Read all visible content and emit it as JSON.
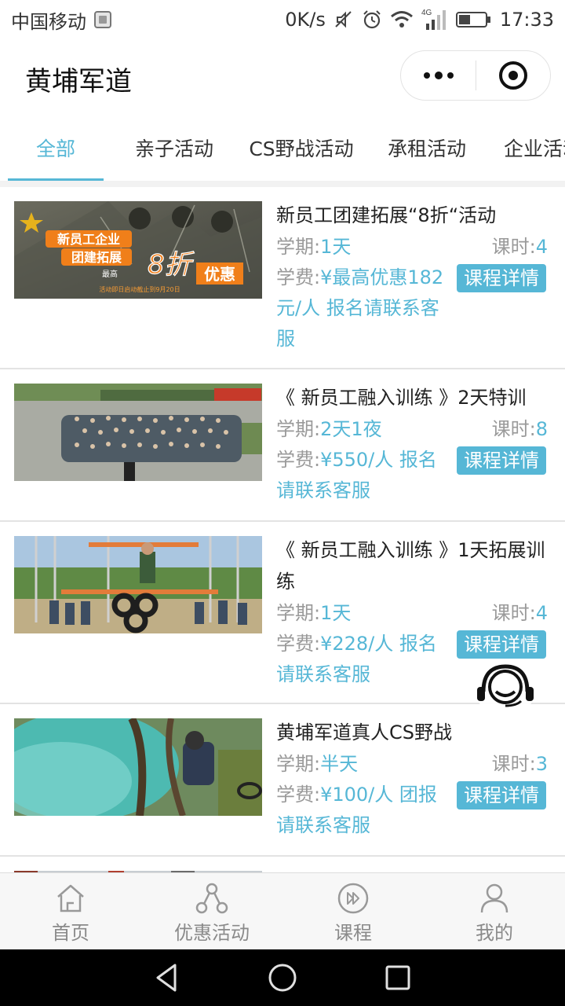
{
  "status_bar": {
    "carrier": "中国移动",
    "net_speed": "0K/s",
    "network_type": "4G",
    "time": "17:33",
    "icons": [
      "sim-icon",
      "mute-icon",
      "alarm-icon",
      "wifi-icon",
      "signal-icon",
      "battery-icon"
    ]
  },
  "header": {
    "title": "黄埔军道"
  },
  "tabs": [
    {
      "label": "全部",
      "active": true
    },
    {
      "label": "亲子活动",
      "active": false
    },
    {
      "label": "CS野战活动",
      "active": false
    },
    {
      "label": "承租活动",
      "active": false
    },
    {
      "label": "企业活动",
      "active": false
    }
  ],
  "courses": [
    {
      "title": "新员工团建拓展“8折“活动",
      "term_label": "学期:",
      "term_value": "1天",
      "hours_label": "课时:",
      "hours_value": "4",
      "fee_label": "学费:",
      "fee_value": "¥最高优惠182元/人 报名请联系客服",
      "detail_button": "课程详情",
      "banner": {
        "line1": "新员工企业",
        "line2": "团建拓展",
        "small": "最高",
        "discount": "8折",
        "highlight": "优惠",
        "footnote": "活动即日启动截止到9月20日"
      }
    },
    {
      "title": "《 新员工融入训练 》2天特训",
      "term_label": "学期:",
      "term_value": "2天1夜",
      "hours_label": "课时:",
      "hours_value": "8",
      "fee_label": "学费:",
      "fee_value": "¥550/人 报名请联系客服",
      "detail_button": "课程详情"
    },
    {
      "title": "《 新员工融入训练 》1天拓展训练",
      "term_label": "学期:",
      "term_value": "1天",
      "hours_label": "课时:",
      "hours_value": "4",
      "fee_label": "学费:",
      "fee_value": "¥228/人 报名请联系客服",
      "detail_button": "课程详情"
    },
    {
      "title": "黄埔军道真人CS野战",
      "term_label": "学期:",
      "term_value": "半天",
      "hours_label": "课时:",
      "hours_value": "3",
      "fee_label": "学费:",
      "fee_value": "¥100/人 团报请联系客服",
      "detail_button": "课程详情"
    }
  ],
  "bottom_nav": [
    {
      "label": "首页",
      "icon": "home-icon"
    },
    {
      "label": "优惠活动",
      "icon": "share-icon"
    },
    {
      "label": "课程",
      "icon": "play-icon"
    },
    {
      "label": "我的",
      "icon": "user-icon"
    }
  ],
  "colors": {
    "accent": "#56b7d6",
    "label_gray": "#9a9a9a",
    "nav_gray": "#8a8a8a"
  }
}
